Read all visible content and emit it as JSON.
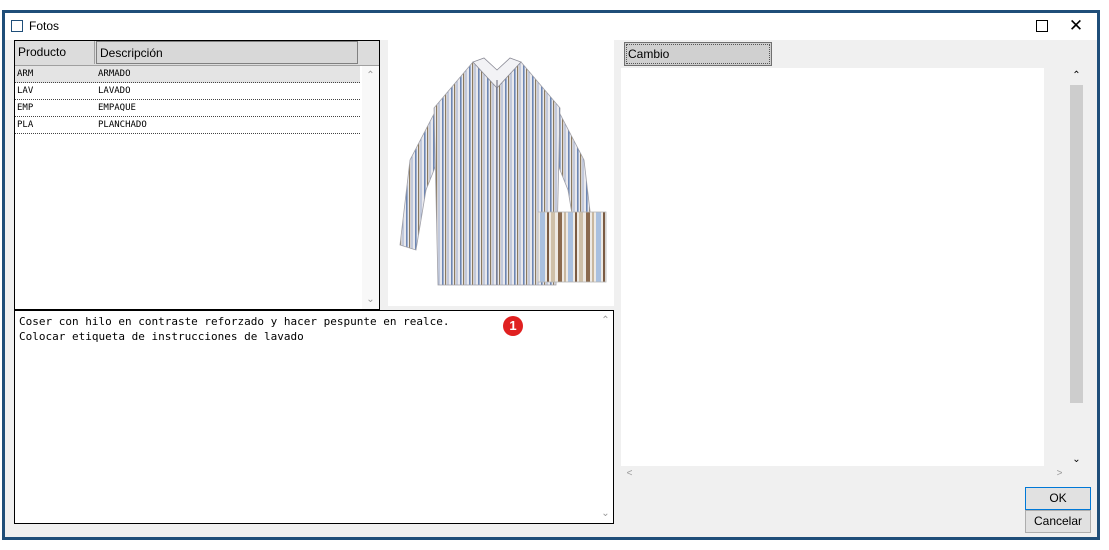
{
  "window": {
    "title": "Fotos"
  },
  "grid": {
    "columns": [
      "Producto",
      "Descripción"
    ],
    "rows": [
      {
        "code": "ARM",
        "desc": "ARMADO"
      },
      {
        "code": "LAV",
        "desc": "LAVADO"
      },
      {
        "code": "EMP",
        "desc": "EMPAQUE"
      },
      {
        "code": "PLA",
        "desc": "PLANCHADO"
      }
    ]
  },
  "notes": {
    "text": "Coser con hilo en contraste reforzado y hacer pespunte en realce.\nColocar etiqueta de instrucciones de lavado",
    "badge": "1"
  },
  "right": {
    "tab": "Cambio"
  },
  "buttons": {
    "ok": "OK",
    "cancel": "Cancelar"
  },
  "colors": {
    "window_border": "#1f4e79",
    "badge": "#e02020"
  }
}
